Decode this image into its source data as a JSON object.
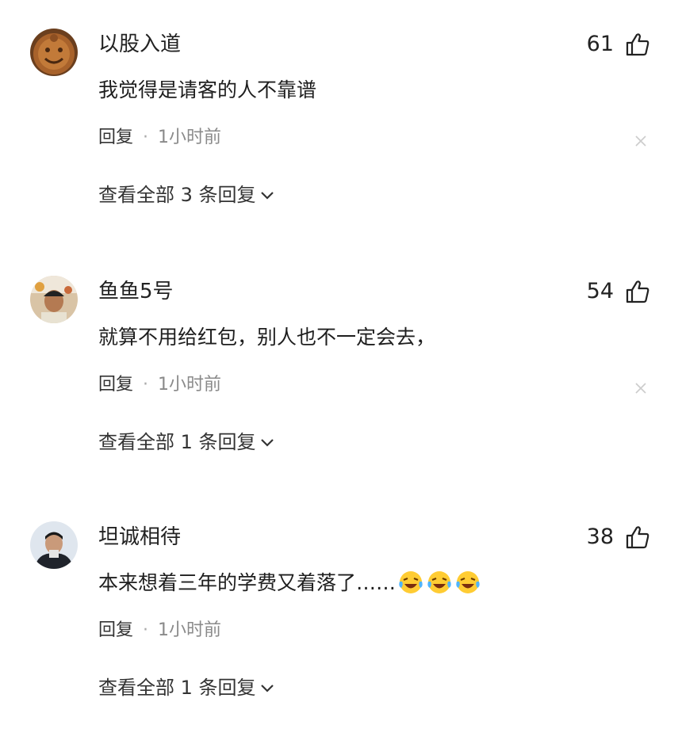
{
  "comments": [
    {
      "username": "以股入道",
      "likes": "61",
      "content": "我觉得是请客的人不靠谱",
      "reply_label": "回复",
      "separator": "·",
      "time": "1小时前",
      "view_all": "查看全部 3 条回复"
    },
    {
      "username": "鱼鱼5号",
      "likes": "54",
      "content": "就算不用给红包，别人也不一定会去，",
      "reply_label": "回复",
      "separator": "·",
      "time": "1小时前",
      "view_all": "查看全部 1 条回复"
    },
    {
      "username": "坦诚相待",
      "likes": "38",
      "content": "本来想着三年的学费又着落了……",
      "reply_label": "回复",
      "separator": "·",
      "time": "1小时前",
      "view_all": "查看全部 1 条回复"
    }
  ],
  "icons": {
    "like": "thumbs-up-icon",
    "close": "close-icon",
    "chevron": "chevron-down-icon",
    "emoji": "laughing-crying-emoji"
  },
  "colors": {
    "text": "#222222",
    "meta": "#8a8a8a",
    "close": "#cccccc"
  }
}
